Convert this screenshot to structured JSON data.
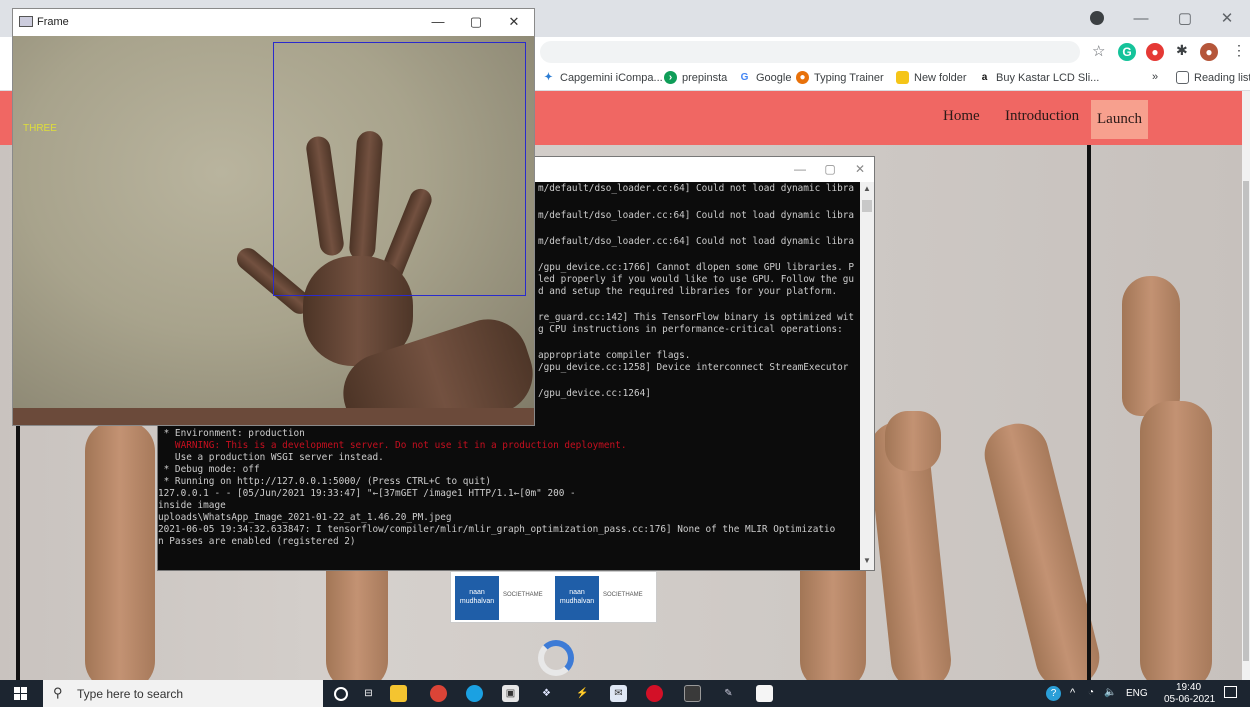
{
  "browser": {
    "tab_close": "✕",
    "window_controls": {
      "minimize": "—",
      "maximize": "▢",
      "close": "✕"
    },
    "bookmarks": [
      {
        "label": "Capgemini iCompa...",
        "icon": "capgemini-icon",
        "color": "#2b7cd3"
      },
      {
        "label": "prepinsta",
        "icon": "prepinsta-icon",
        "color": "#0f9d58"
      },
      {
        "label": "Google",
        "icon": "google-icon",
        "color": "#4285f4"
      },
      {
        "label": "Typing Trainer",
        "icon": "typing-trainer-icon",
        "color": "#e8710a"
      },
      {
        "label": "New folder",
        "icon": "folder-icon",
        "color": "#f5c518"
      },
      {
        "label": "Buy Kastar LCD Sli...",
        "icon": "amazon-icon",
        "color": "#111111"
      }
    ],
    "overflow": "»",
    "reading_list": "Reading list"
  },
  "page": {
    "nav": {
      "home": "Home",
      "introduction": "Introduction",
      "launch": "Launch"
    },
    "nav_color": "#f06763",
    "launch_color": "#f7a08e"
  },
  "terminal": {
    "window_controls": {
      "minimize": "—",
      "maximize": "▢",
      "close": "✕"
    },
    "lines": [
      {
        "text": "m/default/dso_loader.cc:64] Could not load dynamic libra",
        "type": "normal"
      },
      {
        "text": "m/default/dso_loader.cc:64] Could not load dynamic libra",
        "type": "normal"
      },
      {
        "text": "m/default/dso_loader.cc:64] Could not load dynamic libra",
        "type": "normal"
      },
      {
        "text": "/gpu_device.cc:1766] Cannot dlopen some GPU libraries. P",
        "type": "normal"
      },
      {
        "text": "led properly if you would like to use GPU. Follow the gu",
        "type": "normal"
      },
      {
        "text": "d and setup the required libraries for your platform.",
        "type": "normal"
      },
      {
        "text": "re_guard.cc:142] This TensorFlow binary is optimized wit",
        "type": "normal"
      },
      {
        "text": "g CPU instructions in performance-critical operations:",
        "type": "normal"
      },
      {
        "text": "appropriate compiler flags.",
        "type": "normal"
      },
      {
        "text": "/gpu_device.cc:1258] Device interconnect StreamExecutor",
        "type": "normal"
      },
      {
        "text": "/gpu_device.cc:1264]",
        "type": "normal"
      },
      {
        "text": " * Environment: production",
        "type": "normal"
      },
      {
        "text": "   WARNING: This is a development server. Do not use it in a production deployment.",
        "type": "warn"
      },
      {
        "text": "   Use a production WSGI server instead.",
        "type": "normal"
      },
      {
        "text": " * Debug mode: off",
        "type": "normal"
      },
      {
        "text": " * Running on http://127.0.0.1:5000/ (Press CTRL+C to quit)",
        "type": "normal"
      },
      {
        "text": "127.0.0.1 - - [05/Jun/2021 19:33:47] \"←[37mGET /image1 HTTP/1.1←[0m\" 200 -",
        "type": "normal"
      },
      {
        "text": "inside image",
        "type": "normal"
      },
      {
        "text": "uploads\\WhatsApp_Image_2021-01-22_at_1.46.20_PM.jpeg",
        "type": "normal"
      },
      {
        "text": "2021-06-05 19:34:32.633847: I tensorflow/compiler/mlir/mlir_graph_optimization_pass.cc:176] None of the MLIR Optimizatio",
        "type": "normal"
      },
      {
        "text": "n Passes are enabled (registered 2)",
        "type": "normal"
      }
    ]
  },
  "frame_window": {
    "title": "Frame",
    "window_controls": {
      "minimize": "—",
      "maximize": "▢",
      "close": "✕"
    },
    "gesture_label": "THREE",
    "roi_color": "#2a2acd",
    "label_color": "#dede3a"
  },
  "logos": {
    "brand_a": "naan mudhalvan",
    "brand_b": "SOCIETHAME"
  },
  "taskbar": {
    "search_placeholder": "Type here to search",
    "tray": {
      "language": "ENG",
      "time": "19:40",
      "date": "05-06-2021",
      "expand": "^"
    }
  }
}
